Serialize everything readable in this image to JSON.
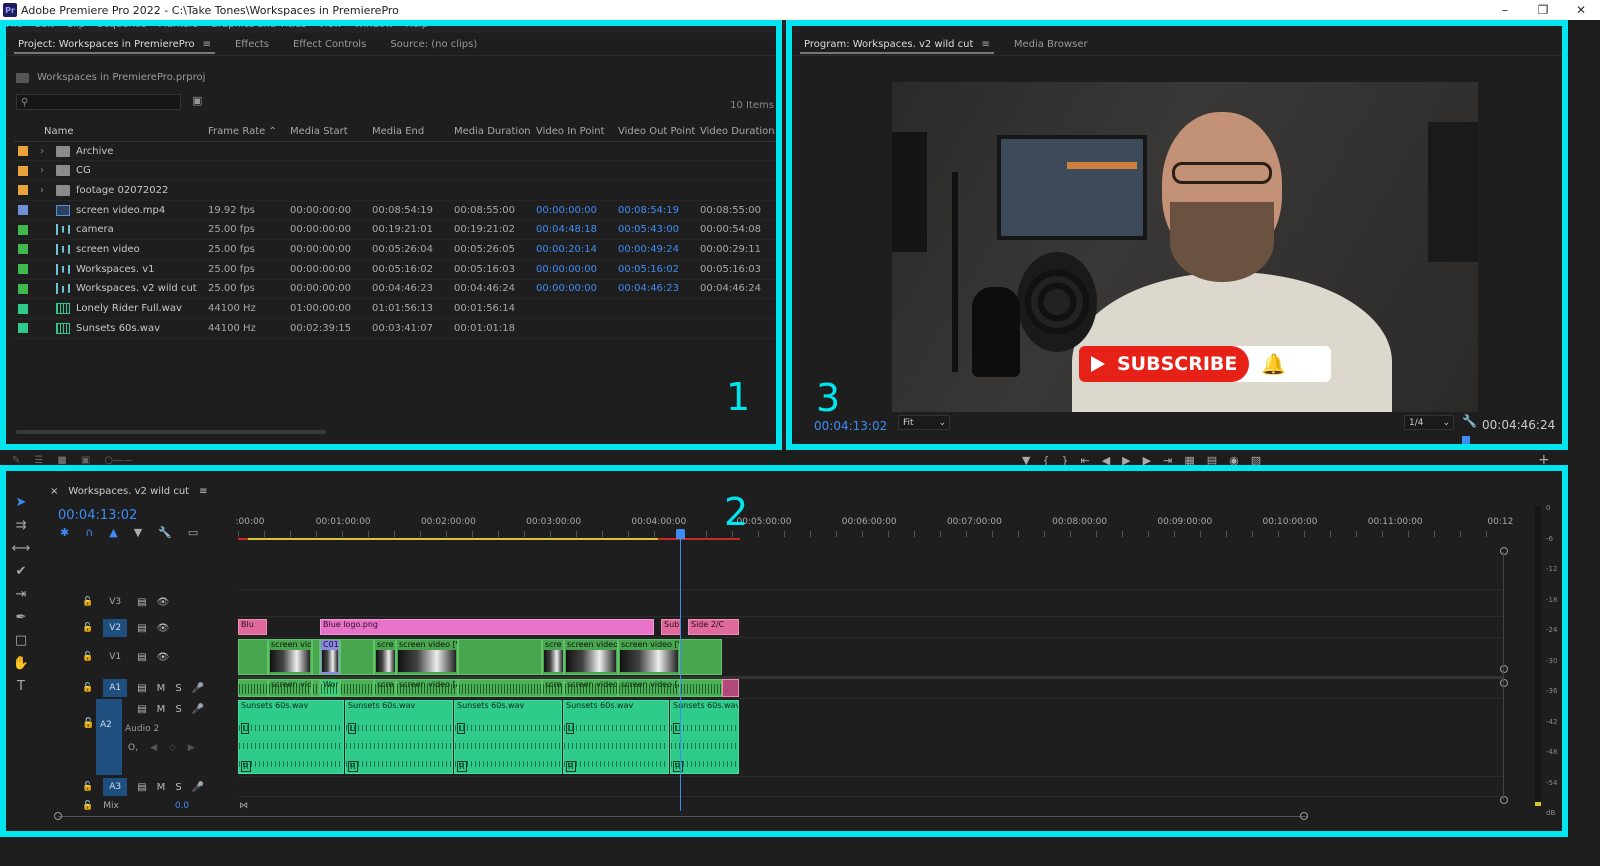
{
  "window": {
    "title": "Adobe Premiere Pro 2022 - C:\\Take Tones\\Workspaces in PremierePro",
    "app_badge": "Pr",
    "controls": [
      "–",
      "❐",
      "✕"
    ]
  },
  "menubar": [
    "File",
    "Edit",
    "Clip",
    "Sequence",
    "Markers",
    "Graphics and Titles",
    "View",
    "Window",
    "Help"
  ],
  "region_labels": {
    "project": "1",
    "timeline": "2",
    "program": "3"
  },
  "project_panel": {
    "tabs": [
      "Project: Workspaces in PremierePro",
      "Effects",
      "Effect Controls",
      "Source: (no clips)"
    ],
    "menu_icon": "≡",
    "path": "Workspaces in PremierePro.prproj",
    "search_placeholder": "",
    "item_count": "10 Items",
    "columns": [
      "Name",
      "Frame Rate",
      "Media Start",
      "Media End",
      "Media Duration",
      "Video In Point",
      "Video Out Point",
      "Video Duration"
    ],
    "rows": [
      {
        "label_color": "#e8a33c",
        "icon": "folder",
        "twirl": "›",
        "name": "Archive",
        "fr": "",
        "ms": "",
        "me": "",
        "md": "",
        "vin": "",
        "vout": "",
        "vd": ""
      },
      {
        "label_color": "#e8a33c",
        "icon": "folder",
        "twirl": "›",
        "name": "CG",
        "fr": "",
        "ms": "",
        "me": "",
        "md": "",
        "vin": "",
        "vout": "",
        "vd": ""
      },
      {
        "label_color": "#e8a33c",
        "icon": "folder",
        "twirl": "›",
        "name": "footage 02072022",
        "fr": "",
        "ms": "",
        "me": "",
        "md": "",
        "vin": "",
        "vout": "",
        "vd": ""
      },
      {
        "label_color": "#6f8fd6",
        "icon": "video",
        "twirl": "",
        "name": "screen video.mp4",
        "fr": "19.92 fps",
        "ms": "00:00:00:00",
        "me": "00:08:54:19",
        "md": "00:08:55:00",
        "vin": "00:00:00:00",
        "vout": "00:08:54:19",
        "vd": "00:08:55:00"
      },
      {
        "label_color": "#3fb84d",
        "icon": "seq",
        "twirl": "",
        "name": "camera",
        "fr": "25.00 fps",
        "ms": "00:00:00:00",
        "me": "00:19:21:01",
        "md": "00:19:21:02",
        "vin": "00:04:48:18",
        "vout": "00:05:43:00",
        "vd": "00:00:54:08"
      },
      {
        "label_color": "#3fb84d",
        "icon": "seq",
        "twirl": "",
        "name": "screen video",
        "fr": "25.00 fps",
        "ms": "00:00:00:00",
        "me": "00:05:26:04",
        "md": "00:05:26:05",
        "vin": "00:00:20:14",
        "vout": "00:00:49:24",
        "vd": "00:00:29:11"
      },
      {
        "label_color": "#3fb84d",
        "icon": "seq",
        "twirl": "",
        "name": "Workspaces. v1",
        "fr": "25.00 fps",
        "ms": "00:00:00:00",
        "me": "00:05:16:02",
        "md": "00:05:16:03",
        "vin": "00:00:00:00",
        "vout": "00:05:16:02",
        "vd": "00:05:16:03"
      },
      {
        "label_color": "#3fb84d",
        "icon": "seq",
        "twirl": "",
        "name": "Workspaces. v2 wild cut",
        "fr": "25.00 fps",
        "ms": "00:00:00:00",
        "me": "00:04:46:23",
        "md": "00:04:46:24",
        "vin": "00:00:00:00",
        "vout": "00:04:46:23",
        "vd": "00:04:46:24"
      },
      {
        "label_color": "#2ecb8a",
        "icon": "audio",
        "twirl": "",
        "name": "Lonely Rider Full.wav",
        "fr": "44100 Hz",
        "ms": "01:00:00:00",
        "me": "01:01:56:13",
        "md": "00:01:56:14",
        "vin": "",
        "vout": "",
        "vd": ""
      },
      {
        "label_color": "#2ecb8a",
        "icon": "audio",
        "twirl": "",
        "name": "Sunsets 60s.wav",
        "fr": "44100 Hz",
        "ms": "00:02:39:15",
        "me": "00:03:41:07",
        "md": "00:01:01:18",
        "vin": "",
        "vout": "",
        "vd": ""
      }
    ]
  },
  "program_monitor": {
    "tabs": [
      "Program: Workspaces. v2 wild cut",
      "Media Browser"
    ],
    "menu_icon": "≡",
    "overlay_text": "SUBSCRIBE",
    "timecode_current": "00:04:13:02",
    "zoom": "Fit",
    "resolution": "1/4",
    "timecode_duration": "00:04:46:24",
    "transport_icons": [
      "marker-icon",
      "in-point-icon",
      "out-point-icon",
      "go-to-in-icon",
      "step-back-icon",
      "play-icon",
      "step-forward-icon",
      "go-to-out-icon",
      "lift-icon",
      "extract-icon",
      "export-frame-icon",
      "compare-icon",
      "add-icon"
    ]
  },
  "timeline": {
    "sequence_tab": "Workspaces. v2 wild cut",
    "close": "×",
    "menu_icon": "≡",
    "timecode": "00:04:13:02",
    "ruler": [
      ":00:00",
      "00:01:00:00",
      "00:02:00:00",
      "00:03:00:00",
      "00:04:00:00",
      "00:05:00:00",
      "00:06:00:00",
      "00:07:00:00",
      "00:08:00:00",
      "00:09:00:00",
      "00:10:00:00",
      "00:11:00:00",
      "00:12"
    ],
    "tracks": {
      "V3": "V3",
      "V2": "V2",
      "V1": "V1",
      "A1": "A1",
      "A2": "A2",
      "A3": "A3",
      "audio2_name": "Audio 2",
      "mix_label": "Mix",
      "mix_value": "0.0",
      "M": "M",
      "S": "S"
    },
    "clips": {
      "v2": [
        "Blu",
        "Blue logo.png",
        "Sub",
        "Side 2/C"
      ],
      "v1": [
        "screen vide",
        "C01",
        "scre",
        "screen video [V]",
        "scre",
        "screen video [",
        "screen video [V]"
      ],
      "a1": [
        "screen vide",
        "Wor",
        "scre",
        "screen video [A]",
        "scre",
        "screen video [",
        "screen video [A]"
      ],
      "a2": [
        "Sunsets 60s.wav",
        "Sunsets 60s.wav",
        "Sunsets 60s.wav",
        "Sunsets 60s.wav",
        "Sunsets 60s.wav"
      ],
      "a2_marks": [
        "L",
        "R"
      ]
    },
    "meter_db": [
      "0",
      "-6",
      "-12",
      "-18",
      "-24",
      "-30",
      "-36",
      "-42",
      "-48",
      "-54",
      "dB"
    ]
  }
}
